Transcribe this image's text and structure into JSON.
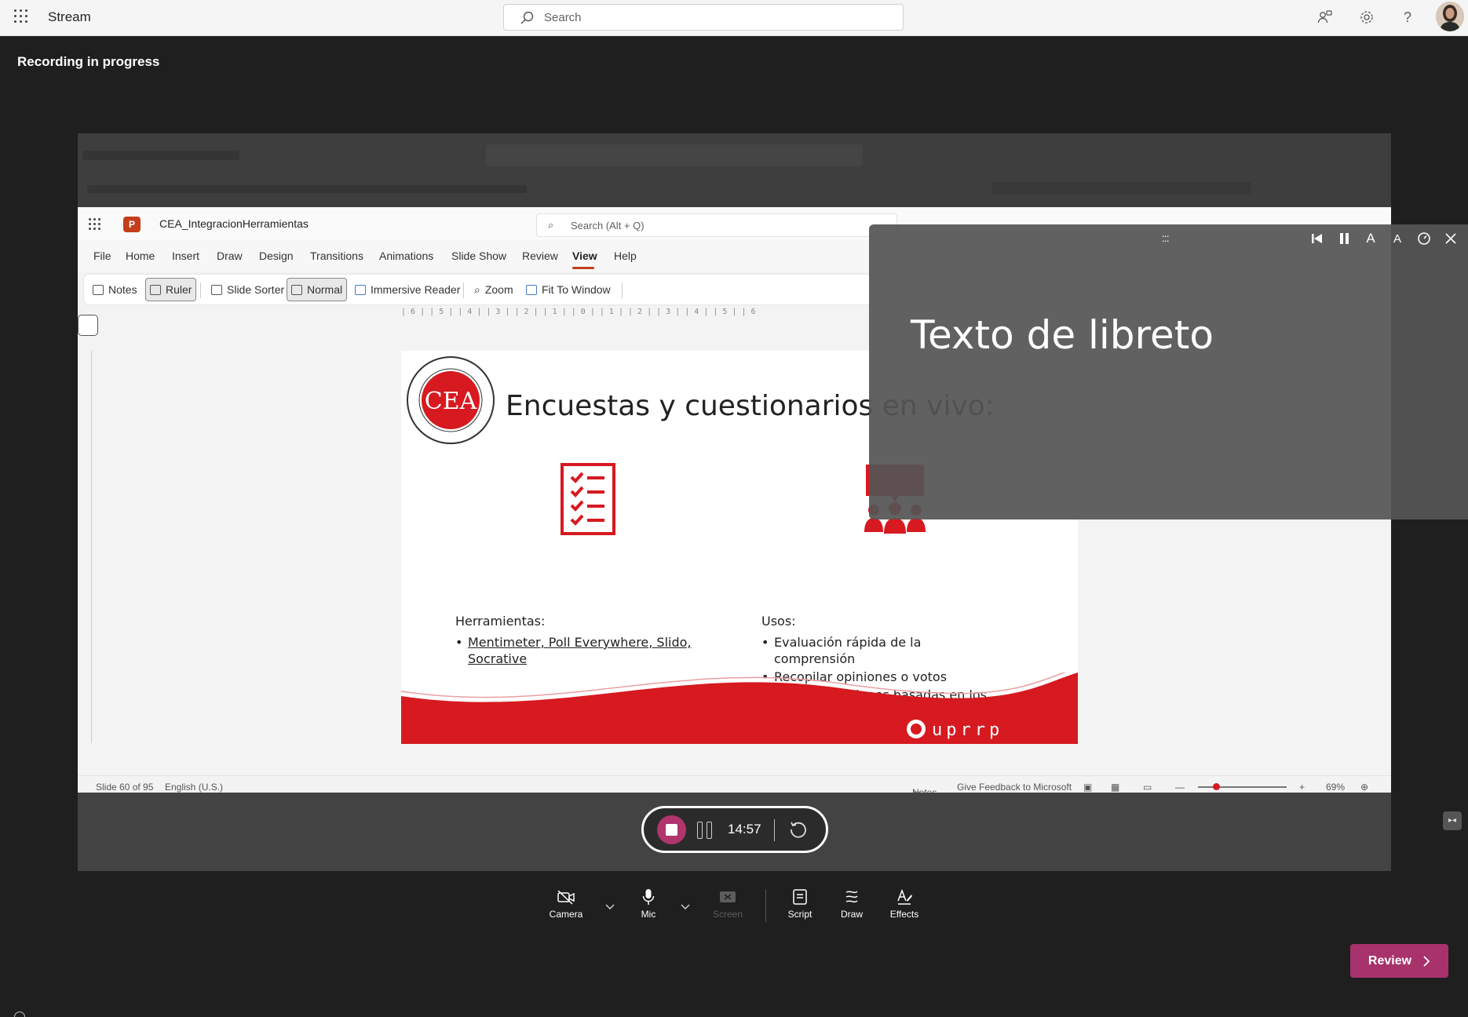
{
  "app": {
    "title": "Stream"
  },
  "search": {
    "placeholder": "Search"
  },
  "header_icons": [
    "people-icon",
    "gear-icon",
    "help-icon",
    "avatar"
  ],
  "help_glyph": "?",
  "status": {
    "recording": "Recording in progress"
  },
  "ppt": {
    "filename": "CEA_IntegracionHerramientas",
    "search_placeholder": "Search (Alt + Q)",
    "menu": [
      "File",
      "Home",
      "Insert",
      "Draw",
      "Design",
      "Transitions",
      "Animations",
      "Slide Show",
      "Review",
      "View",
      "Help"
    ],
    "active_menu": "View",
    "toolbar": {
      "notes": "Notes",
      "ruler": "Ruler",
      "slide_sorter": "Slide Sorter",
      "normal": "Normal",
      "immersive_reader": "Immersive Reader",
      "zoom": "Zoom",
      "fit_to_window": "Fit To Window"
    },
    "ruler_text": "|  6  |  |  5  |  |  4  |  |  3  |  |  2  |  |  1  |  |  0  |  |  1  |  |  2  |  |  3  |  |  4  |  |  5  |  |  6",
    "status": {
      "slide": "Slide 60 of 95",
      "language": "English (U.S.)",
      "notes": "Notes",
      "feedback": "Give Feedback to Microsoft",
      "zoom": "69%",
      "zoom_level": 0.2
    }
  },
  "slide": {
    "title": "Encuestas y cuestionarios en vivo:",
    "tools_heading": "Herramientas:",
    "tools_items": [
      "Mentimeter, Poll Everywhere, Slido,",
      "Socrative"
    ],
    "uses_heading": "Usos:",
    "uses_items": [
      "Evaluación rápida de la comprensión",
      "Recopilar opiniones o votos",
      "Iniciar discusiones basadas en los resultados"
    ],
    "seal_letters": "CEA",
    "brand": "uprrp",
    "accent": "#d71920"
  },
  "recorder": {
    "timer": "14:57",
    "stop_color": "#b0356d"
  },
  "teleprompter": {
    "text": "Texto de libreto",
    "drag_glyph": ":::"
  },
  "bottom_toolbar": {
    "camera": "Camera",
    "mic": "Mic",
    "screen": "Screen",
    "script": "Script",
    "draw": "Draw",
    "effects": "Effects"
  },
  "review": {
    "label": "Review",
    "color": "#a8326b"
  }
}
